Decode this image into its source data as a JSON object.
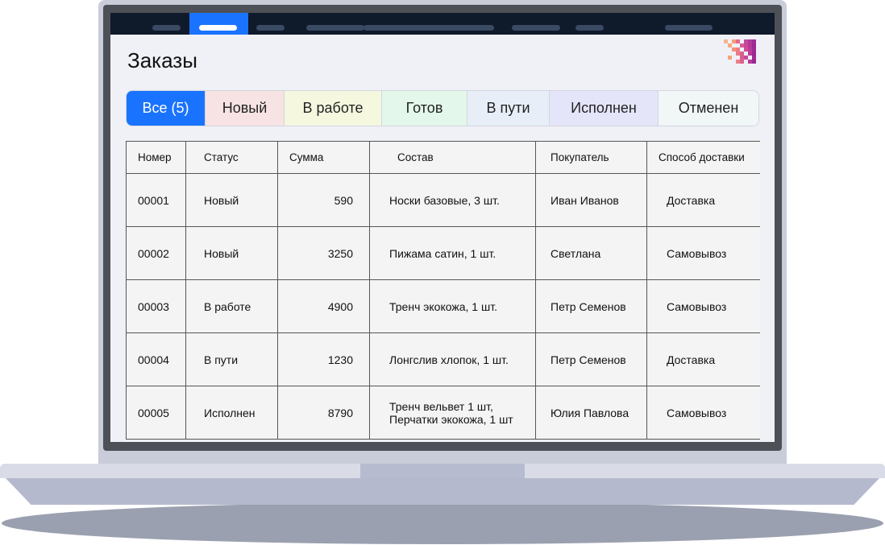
{
  "header": {
    "title": "Заказы"
  },
  "tabs": [
    {
      "label": "Все (5)",
      "active": true
    },
    {
      "label": "Новый"
    },
    {
      "label": "В работе"
    },
    {
      "label": "Готов"
    },
    {
      "label": "В пути"
    },
    {
      "label": "Исполнен"
    },
    {
      "label": "Отменен"
    }
  ],
  "table": {
    "columns": [
      "Номер",
      "Статус",
      "Сумма",
      "Состав",
      "Покупатель",
      "Способ доставки"
    ],
    "rows": [
      {
        "number": "00001",
        "status": "Новый",
        "sum": "590",
        "items": "Носки базовые, 3 шт.",
        "buyer": "Иван Иванов",
        "delivery": "Доставка"
      },
      {
        "number": "00002",
        "status": "Новый",
        "sum": "3250",
        "items": "Пижама сатин, 1 шт.",
        "buyer": "Светлана",
        "delivery": "Самовывоз"
      },
      {
        "number": "00003",
        "status": "В работе",
        "sum": "4900",
        "items": "Тренч экокожа, 1 шт.",
        "buyer": "Петр Семенов",
        "delivery": "Самовывоз"
      },
      {
        "number": "00004",
        "status": "В пути",
        "sum": "1230",
        "items": "Лонгслив хлопок, 1 шт.",
        "buyer": "Петр Семенов",
        "delivery": "Доставка"
      },
      {
        "number": "00005",
        "status": "Исполнен",
        "sum": "8790",
        "items": "Тренч вельвет 1 шт,\nПерчатки экокожа, 1 шт",
        "buyer": "Юлия Павлова",
        "delivery": "Самовывоз"
      }
    ]
  },
  "colors": {
    "accent": "#1a73ff",
    "nav_bg": "#0f1a2b"
  }
}
